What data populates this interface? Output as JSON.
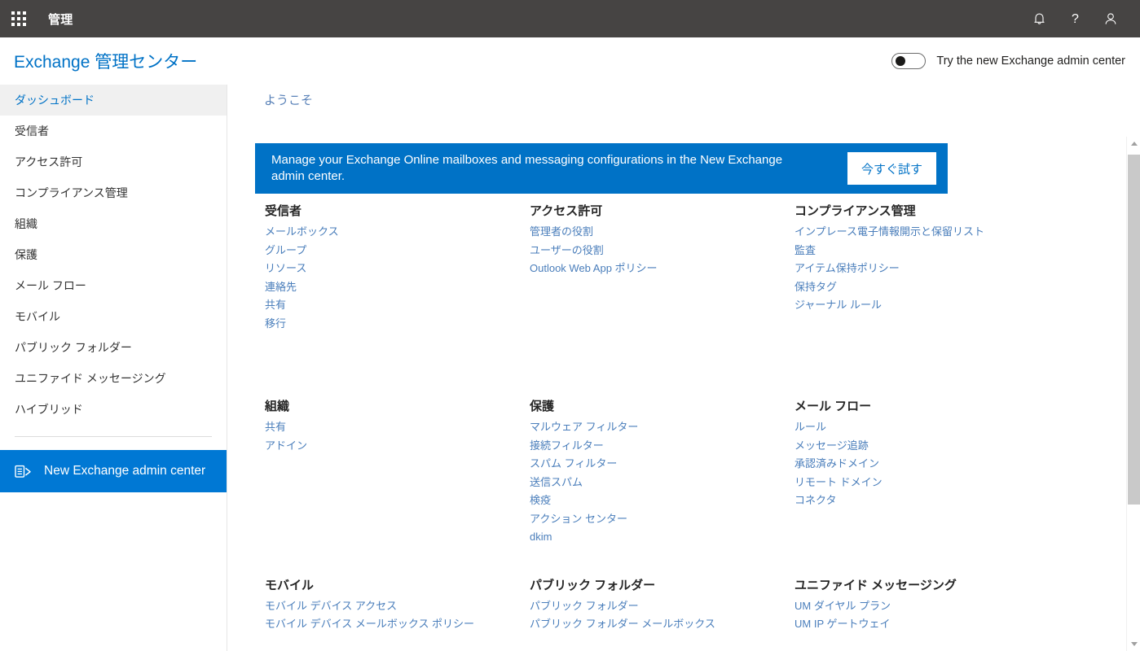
{
  "suite": {
    "app_launcher": "waffle-icon",
    "title": "管理",
    "icons": [
      {
        "name": "bell-icon",
        "label": "通知"
      },
      {
        "name": "help-icon",
        "label": "?"
      },
      {
        "name": "account-icon",
        "label": "アカウント"
      }
    ]
  },
  "brand": {
    "title": "Exchange 管理センター",
    "toggle_label": "Try the new Exchange admin center",
    "toggle_state": "off"
  },
  "sidebar": {
    "items": [
      {
        "label": "ダッシュボード",
        "selected": true
      },
      {
        "label": "受信者",
        "selected": false
      },
      {
        "label": "アクセス許可",
        "selected": false
      },
      {
        "label": "コンプライアンス管理",
        "selected": false
      },
      {
        "label": "組織",
        "selected": false
      },
      {
        "label": "保護",
        "selected": false
      },
      {
        "label": "メール フロー",
        "selected": false
      },
      {
        "label": "モバイル",
        "selected": false
      },
      {
        "label": "パブリック フォルダー",
        "selected": false
      },
      {
        "label": "ユニファイド メッセージング",
        "selected": false
      },
      {
        "label": "ハイブリッド",
        "selected": false
      }
    ],
    "new_eac": {
      "label": "New Exchange admin center",
      "icon": "exchange-icon",
      "accent": "#0078d4"
    }
  },
  "main": {
    "welcome": "ようこそ",
    "banner": {
      "text": "Manage your Exchange Online mailboxes and messaging configurations in the New Exchange admin center.",
      "button": "今すぐ試す",
      "background": "#0072c6"
    },
    "groups": [
      {
        "title": "受信者",
        "links": [
          "メールボックス",
          "グループ",
          "リソース",
          "連絡先",
          "共有",
          "移行"
        ]
      },
      {
        "title": "アクセス許可",
        "links": [
          "管理者の役割",
          "ユーザーの役割",
          "Outlook Web App ポリシー"
        ]
      },
      {
        "title": "コンプライアンス管理",
        "links": [
          "インプレース電子情報開示と保留リスト",
          "監査",
          "アイテム保持ポリシー",
          "保持タグ",
          "ジャーナル ルール"
        ]
      },
      {
        "title": "組織",
        "links": [
          "共有",
          "アドイン"
        ]
      },
      {
        "title": "保護",
        "links": [
          "マルウェア フィルター",
          "接続フィルター",
          "スパム フィルター",
          "送信スパム",
          "検疫",
          "アクション センター",
          "dkim"
        ]
      },
      {
        "title": "メール フロー",
        "links": [
          "ルール",
          "メッセージ追跡",
          "承認済みドメイン",
          "リモート ドメイン",
          "コネクタ"
        ]
      },
      {
        "title": "モバイル",
        "links": [
          "モバイル デバイス アクセス",
          "モバイル デバイス メールボックス ポリシー"
        ]
      },
      {
        "title": "パブリック フォルダー",
        "links": [
          "パブリック フォルダー",
          "パブリック フォルダー メールボックス"
        ]
      },
      {
        "title": "ユニファイド メッセージング",
        "links": [
          "UM ダイヤル プラン",
          "UM IP ゲートウェイ"
        ]
      }
    ]
  },
  "scrollbar": {
    "up_icon": "chevron-up-icon",
    "down_icon": "chevron-down-icon"
  }
}
